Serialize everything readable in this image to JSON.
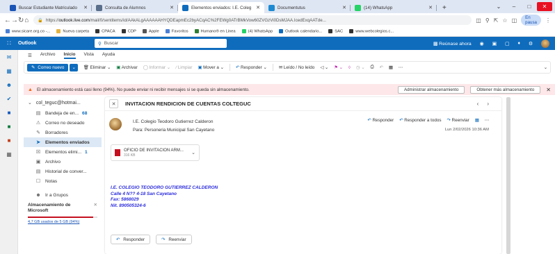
{
  "browser": {
    "tabs": [
      {
        "label": "Buscar Estudiante Matriculado",
        "color": "#1a55b5",
        "active": false
      },
      {
        "label": "Consulta de Alumnos",
        "color": "#5a6f8c",
        "active": false
      },
      {
        "label": "Elementos enviados: I.E. Coleg",
        "color": "#0f6cbd",
        "active": true
      },
      {
        "label": "Documentutus",
        "color": "#1f8ad2",
        "active": false
      },
      {
        "label": "(14) WhatsApp",
        "color": "#25d366",
        "active": false
      }
    ],
    "url_prefix": "https://",
    "url_host": "outlook.live.com",
    "url_rest": "/mail/0/sentitems/id/AAkALgAAAAAAHYQDEapmEc2byACqAC%2FEWg0ATrBMkVow60ZVGzVi0DsMJAA.IcedExqAATde...",
    "profile_label": "En pausa"
  },
  "bookmarks": [
    {
      "label": "www.sicare.org.co -...",
      "color": "#4a7fd4"
    },
    {
      "label": "Nueva carpeta",
      "color": "#e3b341"
    },
    {
      "label": "CPACA",
      "color": "#333333"
    },
    {
      "label": "CDP",
      "color": "#333333"
    },
    {
      "label": "Apple",
      "color": "#555555"
    },
    {
      "label": "Favoritos",
      "color": "#4a7fd4"
    },
    {
      "label": "Humano® en Linea",
      "color": "#2f7d32"
    },
    {
      "label": "(4) WhatsApp",
      "color": "#25d366"
    },
    {
      "label": "Outlook calendario...",
      "color": "#0f6cbd"
    },
    {
      "label": "SAC",
      "color": "#333333"
    },
    {
      "label": "www.webcolegios.c...",
      "color": "#333333"
    }
  ],
  "outlook": {
    "brand": "Outlook",
    "search_placeholder": "Buscar",
    "meet_now": "Reúnase ahora"
  },
  "ribbon": {
    "tabs": [
      "Archivo",
      "Inicio",
      "Vista",
      "Ayuda"
    ],
    "active_tab": "Inicio",
    "new_mail": "Correo nuevo",
    "delete": "Eliminar",
    "archive": "Archivar",
    "report": "Informar",
    "sweep": "Limpiar",
    "move_to": "Mover a",
    "reply": "Responder",
    "read_unread": "Leído / No leído"
  },
  "warning": {
    "text": "El almacenamiento está casi lleno (94%). No puede enviar ni recibir mensajes si se queda sin almacenamiento.",
    "manage": "Administrar almacenamiento",
    "get_more": "Obtener más almacenamiento"
  },
  "folders": {
    "account": "col_teguc@hotmai...",
    "items": [
      {
        "label": "Bandeja de en...",
        "count": "68",
        "icon": "inbox-icon",
        "glyph": "▤"
      },
      {
        "label": "Correo no deseado",
        "count": "",
        "icon": "junk-icon",
        "glyph": "⚠"
      },
      {
        "label": "Borradores",
        "count": "",
        "icon": "draft-icon",
        "glyph": "✎"
      },
      {
        "label": "Elementos enviados",
        "count": "",
        "icon": "sent-icon",
        "glyph": "➤"
      },
      {
        "label": "Elementos elimi...",
        "count": "1",
        "icon": "trash-icon",
        "glyph": "☒"
      },
      {
        "label": "Archivo",
        "count": "",
        "icon": "archive-icon",
        "glyph": "▣"
      },
      {
        "label": "Historial de conver...",
        "count": "",
        "icon": "history-icon",
        "glyph": "▤"
      },
      {
        "label": "Notas",
        "count": "",
        "icon": "notes-icon",
        "glyph": "☐"
      }
    ],
    "selected_index": 3,
    "groups": "Ir a Grupos",
    "storage_title": "Almacenamiento de Microsoft",
    "storage_text": "4,7 GB usados de 5 GB (94%)",
    "storage_fraction": 0.94
  },
  "message": {
    "subject": "INVITACION RENDICION DE CUENTAS COLTEGUC",
    "from": "I.E. Colegio Teodoro Gutierrez Calderon",
    "to_label": "Para:",
    "to": "Personeria Municipal San Cayetano",
    "reply": "Responder",
    "reply_all": "Responder a todos",
    "forward": "Reenviar",
    "date": "Lun 2/02/2026 10:36 AM",
    "attachment": {
      "name": "OFICIO DE INVITACION ARM...",
      "size": "316 KB"
    },
    "signature": [
      "I.E. COLEGIO TEODORO GUTIERREZ CALDERON",
      "Calle 4 N?? 4-18 San Cayetano",
      "Fax: 5868029",
      "Nit. 890505324-6"
    ],
    "reply_button": "Responder",
    "forward_button": "Reenviar"
  }
}
